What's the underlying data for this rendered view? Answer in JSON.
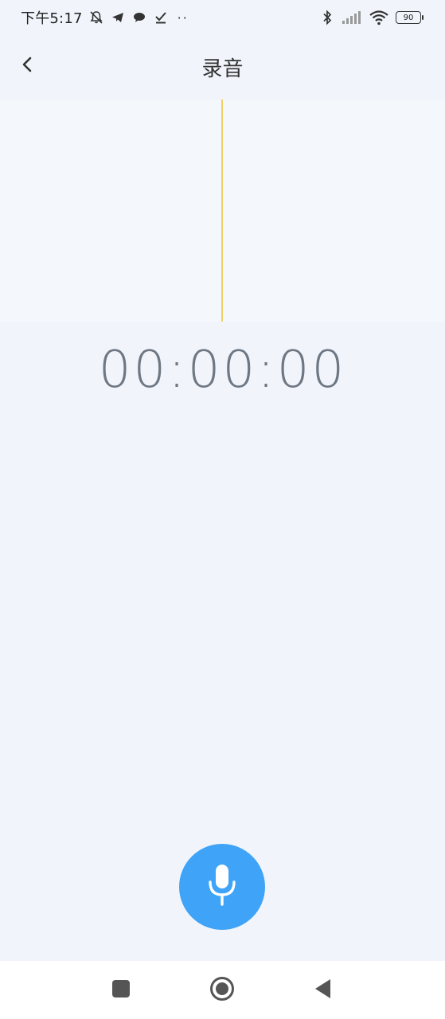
{
  "status_bar": {
    "time": "下午5:17",
    "left_icons": [
      "bell-muted-icon",
      "telegram-icon",
      "chat-bubble-icon",
      "checkmark-icon"
    ],
    "more_dots": "··",
    "right_icons": [
      "bluetooth-icon",
      "signal-icon",
      "wifi-icon"
    ],
    "battery_level": "90"
  },
  "header": {
    "title": "录音",
    "back_icon": "chevron-left-icon"
  },
  "recorder": {
    "timer": "00:00:00",
    "playhead_color": "#f1cf64",
    "record_button_color": "#3fa3f7",
    "record_icon": "microphone-icon"
  },
  "nav_bar": {
    "recents_icon": "square-icon",
    "home_icon": "circle-icon",
    "back_icon": "triangle-back-icon"
  }
}
